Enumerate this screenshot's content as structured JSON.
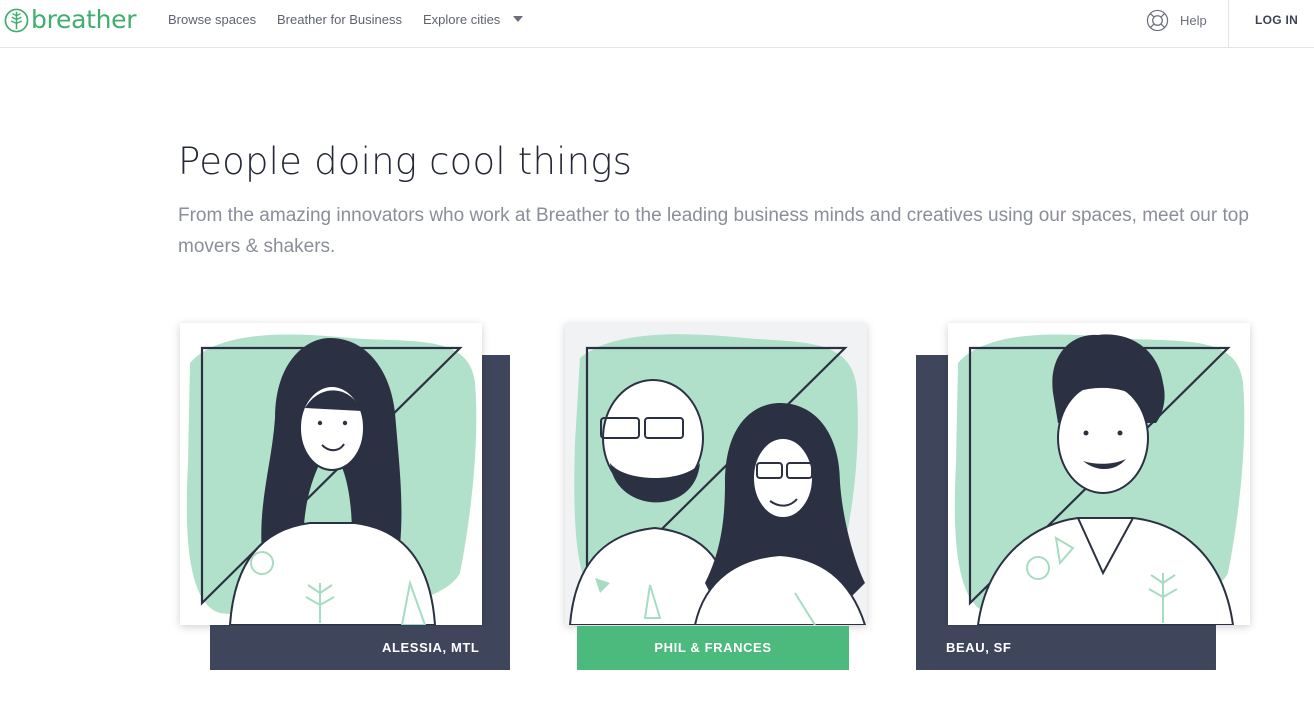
{
  "nav": {
    "logo_text": "breather",
    "links": [
      {
        "label": "Browse spaces"
      },
      {
        "label": "Breather for Business"
      },
      {
        "label": "Explore cities"
      }
    ],
    "help_label": "Help",
    "login_label": "LOG IN"
  },
  "hero": {
    "title": "People doing cool things",
    "subtitle": "From the amazing innovators who work at Breather to the leading business minds and creatives using our spaces, meet our top movers & shakers."
  },
  "cards": [
    {
      "label": "ALESSIA, MTL"
    },
    {
      "label": "PHIL & FRANCES"
    },
    {
      "label": "BEAU, SF"
    }
  ],
  "colors": {
    "brand_green": "#3fae6e",
    "navy": "#3f465c",
    "label_green": "#4cb97d",
    "wash_green": "#a5dcc2"
  }
}
